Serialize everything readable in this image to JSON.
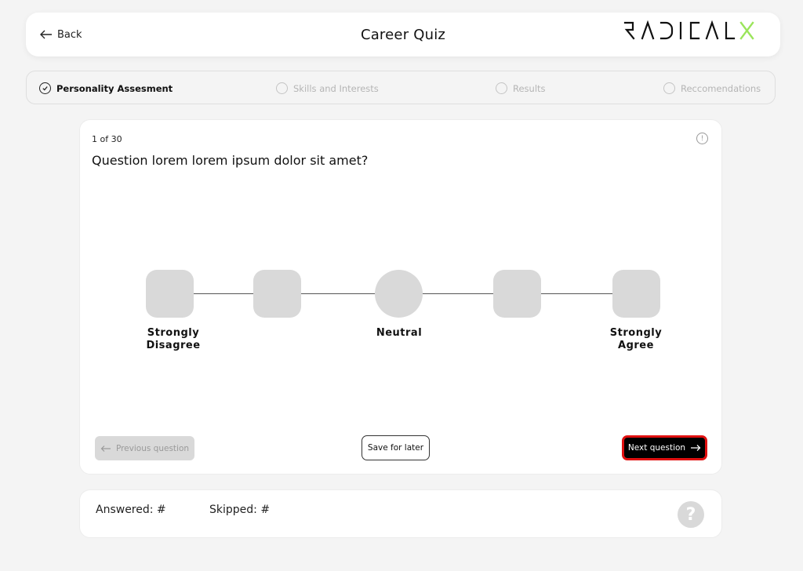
{
  "header": {
    "back_label": "Back",
    "title": "Career Quiz",
    "logo_text_main": "RADICAL",
    "logo_text_accent": "X"
  },
  "colors": {
    "accent": "#9be55b",
    "next_border": "#e01010",
    "option_fill": "#d9d9d9"
  },
  "steps": [
    {
      "label": "Personality Assesment",
      "state": "completed"
    },
    {
      "label": "Skills and Interests",
      "state": "pending"
    },
    {
      "label": "Results",
      "state": "pending"
    },
    {
      "label": "Reccomendations",
      "state": "pending"
    }
  ],
  "question": {
    "counter": "1 of 30",
    "text": "Question lorem lorem ipsum dolor sit amet?"
  },
  "scale": {
    "label_strongly_disagree_line1": "Strongly",
    "label_strongly_disagree_line2": "Disagree",
    "label_neutral": "Neutral",
    "label_strongly_agree_line1": "Strongly",
    "label_strongly_agree_line2": "Agree"
  },
  "buttons": {
    "previous": "Previous question",
    "save": "Save for later",
    "next": "Next question"
  },
  "footer": {
    "answered": "Answered: #",
    "skipped": "Skipped: #",
    "help_glyph": "?"
  },
  "icons": {
    "info": "!"
  }
}
